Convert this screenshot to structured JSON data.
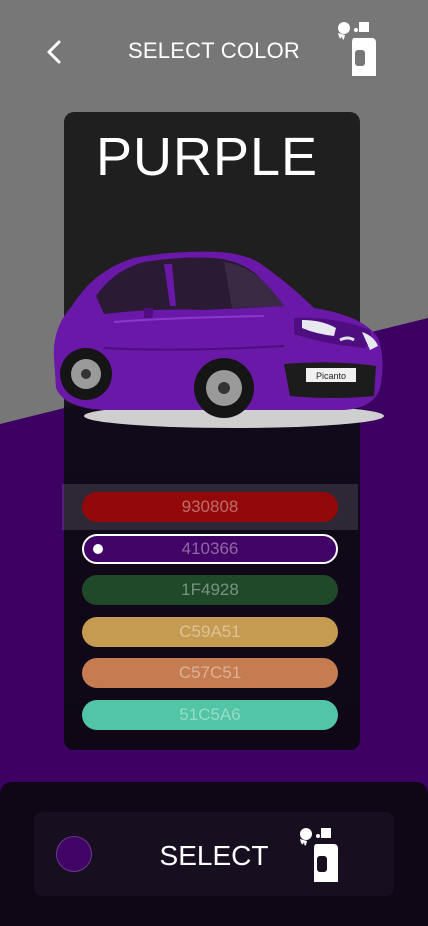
{
  "header": {
    "title": "SELECT COLOR",
    "back_icon": "chevron-left-icon",
    "action_icon": "spray-paint-icon"
  },
  "card": {
    "color_name": "PURPLE",
    "car_badge": "Picanto"
  },
  "colors": [
    {
      "code": "930808",
      "hex": "#930808"
    },
    {
      "code": "410366",
      "hex": "#410366",
      "selected": true
    },
    {
      "code": "1F4928",
      "hex": "#1F4928"
    },
    {
      "code": "C59A51",
      "hex": "#C59A51"
    },
    {
      "code": "C57C51",
      "hex": "#C57C51"
    },
    {
      "code": "51C5A6",
      "hex": "#51C5A6"
    }
  ],
  "footer": {
    "select_label": "SELECT",
    "selected_hex": "#410366",
    "action_icon": "spray-paint-icon"
  }
}
